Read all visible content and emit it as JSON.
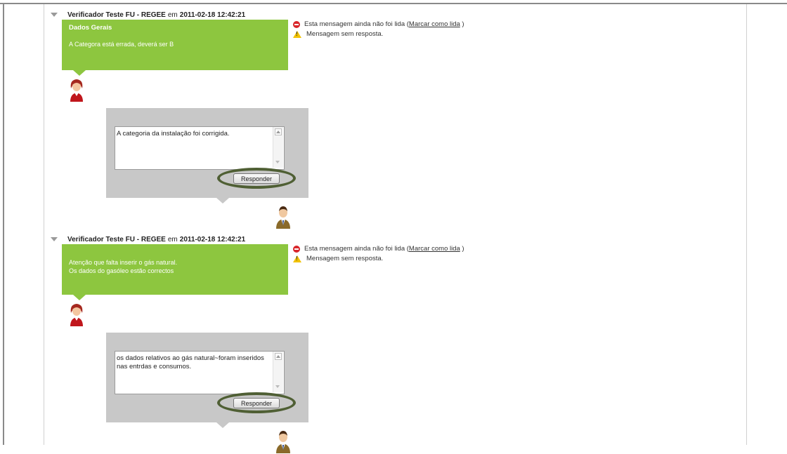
{
  "messages": [
    {
      "sender": "Verificador Teste FU - REGEE",
      "separator": "em",
      "datetime": "2011-02-18 12:42:21",
      "bubble_title": "Dados Gerais",
      "bubble_text": "A Categora está errada, deverá ser B",
      "status": {
        "unread_text": "Esta mensagem ainda não foi lida (",
        "mark_read_link": "Marcar como lida",
        "unread_close": " )",
        "no_reply_text": "Mensagem sem resposta."
      },
      "reply_value": "A categoria da instalação foi corrigida.",
      "reply_button": "Responder"
    },
    {
      "sender": "Verificador Teste FU - REGEE",
      "separator": "em",
      "datetime": "2011-02-18 12:42:21",
      "bubble_title": "",
      "bubble_text": "Atenção que falta inserir o gás natural.\nOs dados do gasóleo estão correctos",
      "status": {
        "unread_text": "Esta mensagem ainda não foi lida (",
        "mark_read_link": "Marcar como lida",
        "unread_close": " )",
        "no_reply_text": "Mensagem sem resposta."
      },
      "reply_value": "os dados relativos ao gás natural~foram inseridos nas entrdas e consumos.",
      "reply_button": "Responder"
    }
  ],
  "colors": {
    "bubble_green": "#8dc63f",
    "reply_gray": "#c8c8c8",
    "highlight_ring": "#4f5f34",
    "unread_icon": "#d9252a",
    "warning_icon": "#f2c200"
  },
  "icons": {
    "collapse": "triangle-down-icon",
    "unread": "stop-icon",
    "no_reply": "warning-icon",
    "author_avatar": "woman-avatar-icon",
    "responder_avatar": "man-avatar-icon"
  }
}
